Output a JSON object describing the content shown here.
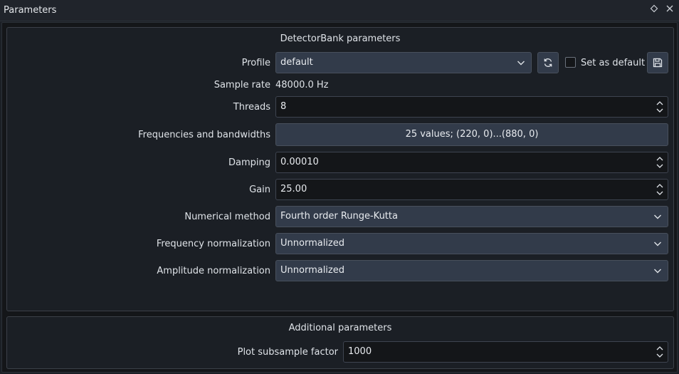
{
  "window": {
    "title": "Parameters",
    "float_icon": "diamond-icon",
    "close_icon": "close-icon"
  },
  "detectorbank": {
    "group_title": "DetectorBank parameters",
    "profile_label": "Profile",
    "profile_value": "default",
    "reload_icon": "refresh-icon",
    "set_default_label": "Set as default",
    "set_default_checked": false,
    "save_icon": "save-icon",
    "sample_rate_label": "Sample rate",
    "sample_rate_value": "48000.0 Hz",
    "threads_label": "Threads",
    "threads_value": "8",
    "freq_bw_label": "Frequencies and bandwidths",
    "freq_bw_value": "25 values; (220, 0)...(880, 0)",
    "damping_label": "Damping",
    "damping_value": "0.00010",
    "gain_label": "Gain",
    "gain_value": "25.00",
    "method_label": "Numerical method",
    "method_value": "Fourth order Runge-Kutta",
    "freq_norm_label": "Frequency normalization",
    "freq_norm_value": "Unnormalized",
    "amp_norm_label": "Amplitude normalization",
    "amp_norm_value": "Unnormalized"
  },
  "additional": {
    "group_title": "Additional parameters",
    "subsample_label": "Plot subsample factor",
    "subsample_value": "1000"
  },
  "colors": {
    "background": "#1c2026",
    "panel": "#1b1f25",
    "combo": "#323b4a",
    "field": "#141619",
    "text": "#dfe3e8"
  }
}
